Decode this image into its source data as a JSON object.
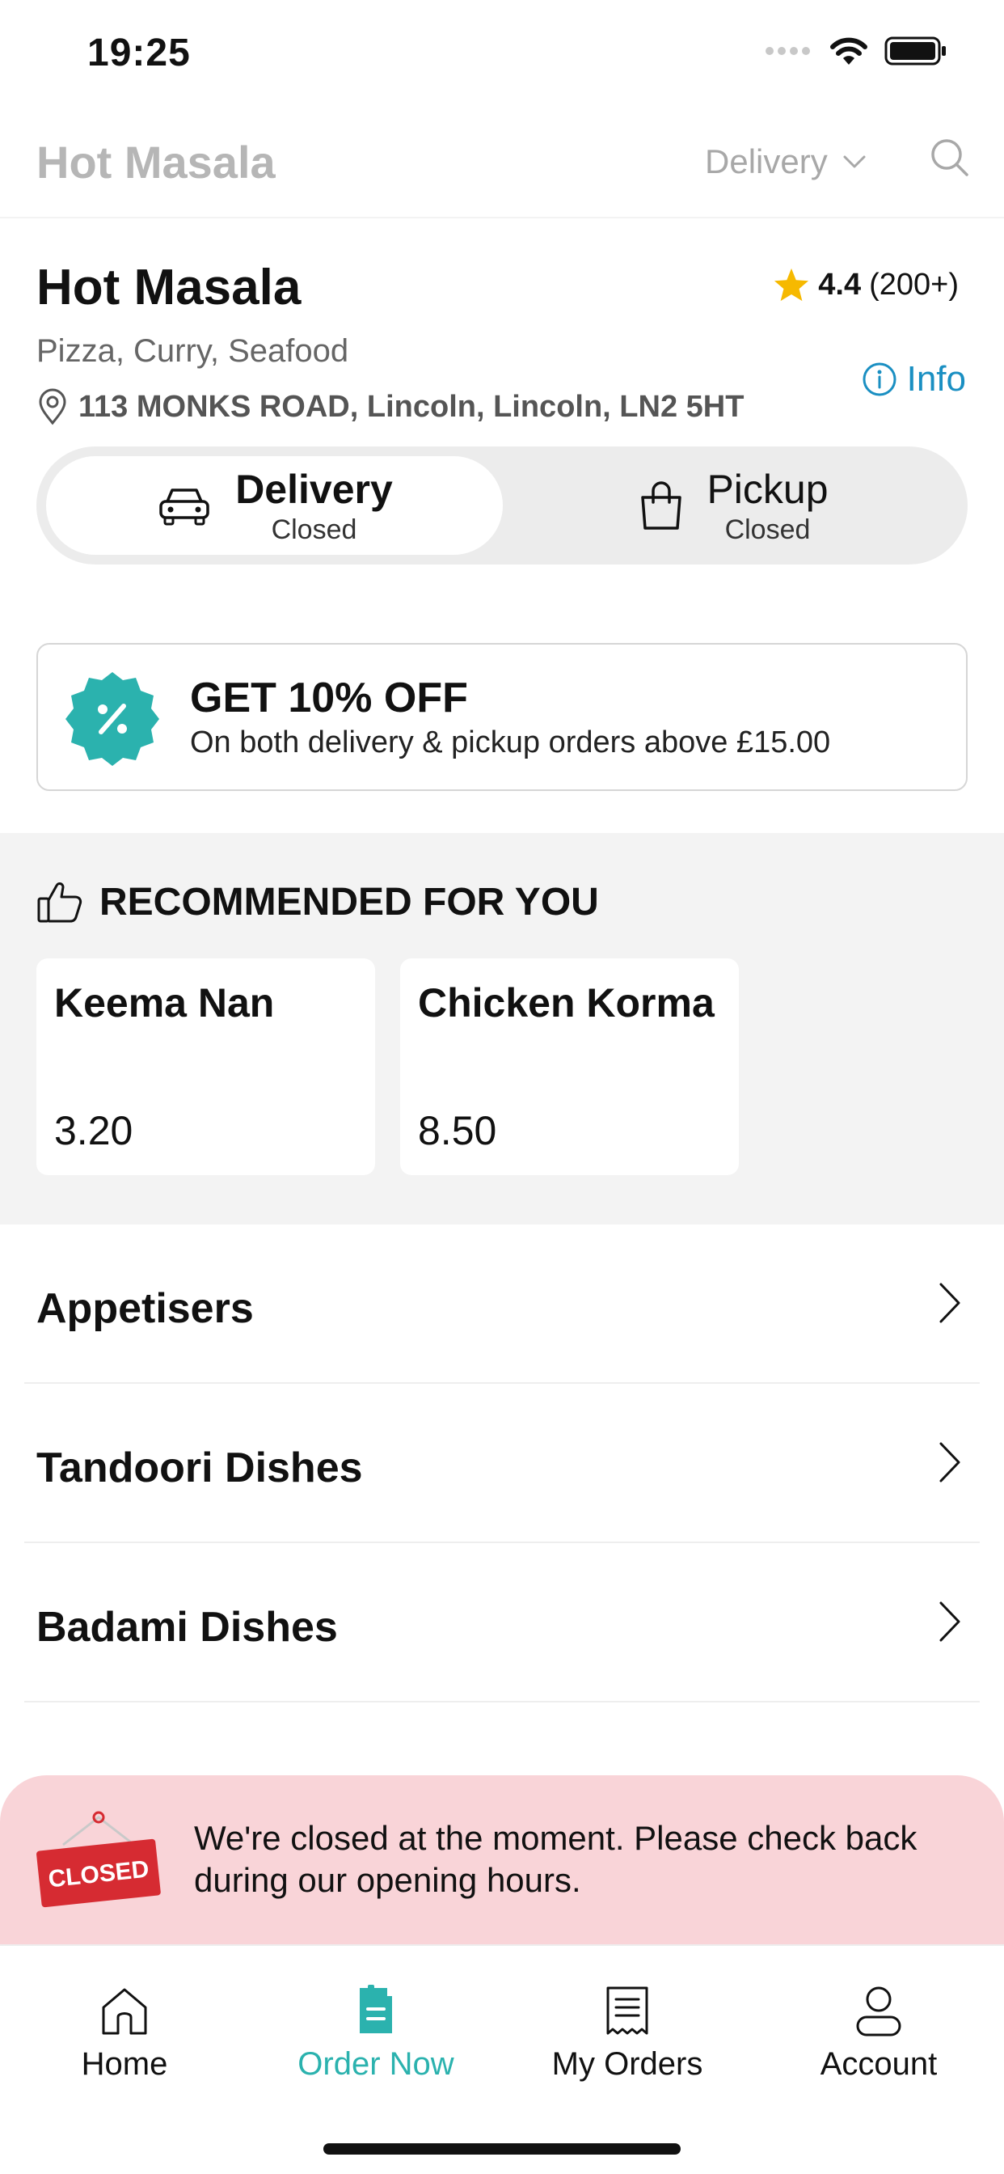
{
  "status_bar": {
    "time": "19:25"
  },
  "header": {
    "title": "Hot Masala",
    "mode_label": "Delivery"
  },
  "restaurant": {
    "name": "Hot Masala",
    "rating": "4.4",
    "rating_count": "(200+)",
    "cuisines": "Pizza, Curry, Seafood",
    "info_label": "Info",
    "address": "113 MONKS ROAD, Lincoln, Lincoln, LN2 5HT"
  },
  "modes": [
    {
      "title": "Delivery",
      "status": "Closed",
      "icon": "car-icon",
      "selected": true
    },
    {
      "title": "Pickup",
      "status": "Closed",
      "icon": "shopping-bag-icon",
      "selected": false
    }
  ],
  "promo": {
    "title": "GET 10% OFF",
    "subtitle": "On both delivery & pickup orders above £15.00",
    "icon": "percent-badge-icon",
    "color": "#2bb2ae"
  },
  "recommended": {
    "heading": "RECOMMENDED FOR YOU",
    "items": [
      {
        "name": "Keema Nan",
        "price": "3.20"
      },
      {
        "name": "Chicken Korma",
        "price": "8.50"
      }
    ]
  },
  "categories": [
    "Appetisers",
    "Tandoori Dishes",
    "Badami Dishes"
  ],
  "closed_banner": {
    "sign_text": "CLOSED",
    "message": "We're closed at the moment. Please check back during our opening hours."
  },
  "tabs": [
    {
      "label": "Home",
      "icon": "home-icon",
      "active": false
    },
    {
      "label": "Order Now",
      "icon": "order-icon",
      "active": true
    },
    {
      "label": "My Orders",
      "icon": "receipt-icon",
      "active": false
    },
    {
      "label": "Account",
      "icon": "user-icon",
      "active": false
    }
  ],
  "colors": {
    "accent": "#2bb2ae",
    "info_link": "#1a8fc2",
    "star": "#f6b900",
    "closed_banner_bg": "#f9d4d8",
    "closed_sign": "#d62b32"
  }
}
